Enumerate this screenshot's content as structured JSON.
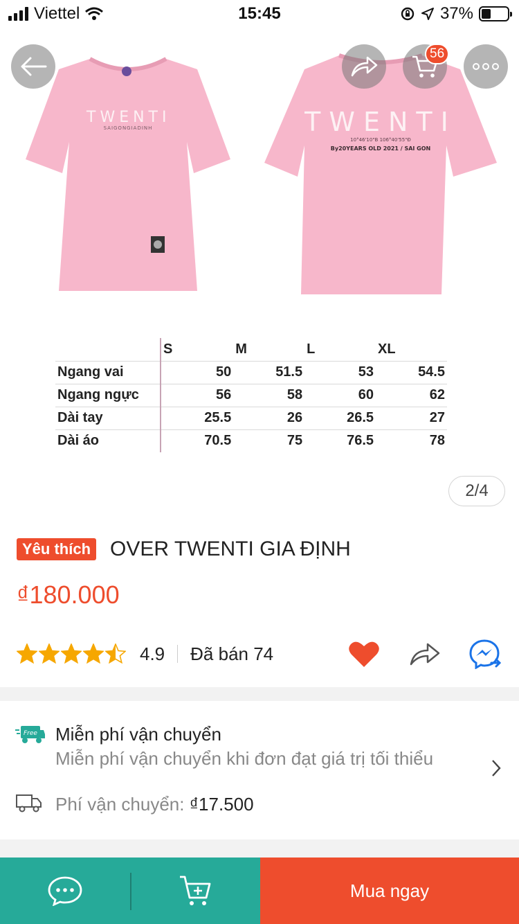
{
  "status_bar": {
    "carrier": "Viettel",
    "time": "15:45",
    "battery": "37%",
    "battery_level": 0.37
  },
  "gallery": {
    "page_indicator": "2/4",
    "cart_badge": "56",
    "shirt_color": "#f7b7cb",
    "front_print": {
      "logo": "TWENTI",
      "sub": "SAIGONGIADINH"
    },
    "back_print": {
      "logo": "TWENTI",
      "coords": "10°46'10\"B 106°40'55\"Đ",
      "tagline": "By20YEARS OLD 2021 / SAI GON"
    },
    "size_table": {
      "headers": [
        "",
        "S",
        "M",
        "L",
        "XL"
      ],
      "rows": [
        {
          "label": "Ngang vai",
          "values": [
            "50",
            "51.5",
            "53",
            "54.5"
          ]
        },
        {
          "label": "Ngang ngực",
          "values": [
            "56",
            "58",
            "60",
            "62"
          ]
        },
        {
          "label": "Dài tay",
          "values": [
            "25.5",
            "26",
            "26.5",
            "27"
          ]
        },
        {
          "label": "Dài áo",
          "values": [
            "70.5",
            "75",
            "76.5",
            "78"
          ]
        }
      ]
    }
  },
  "product": {
    "tag": "Yêu thích",
    "title": "OVER TWENTI GIA ĐỊNH",
    "price": "₫180.000",
    "rating_value": "4.9",
    "rating_stars": 4.5,
    "sold": "Đã bán 74"
  },
  "shipping": {
    "title": "Miễn phí vận chuyển",
    "description": "Miễn phí vận chuyển khi đơn đạt giá trị tối thiểu",
    "free_badge": "Free",
    "fee_label": "Phí vận chuyển:",
    "fee_value": "₫17.500"
  },
  "bottom_bar": {
    "buy_now": "Mua ngay"
  },
  "colors": {
    "brand": "#ee4d2d",
    "teal": "#26aa99",
    "messenger": "#1a73e8"
  }
}
